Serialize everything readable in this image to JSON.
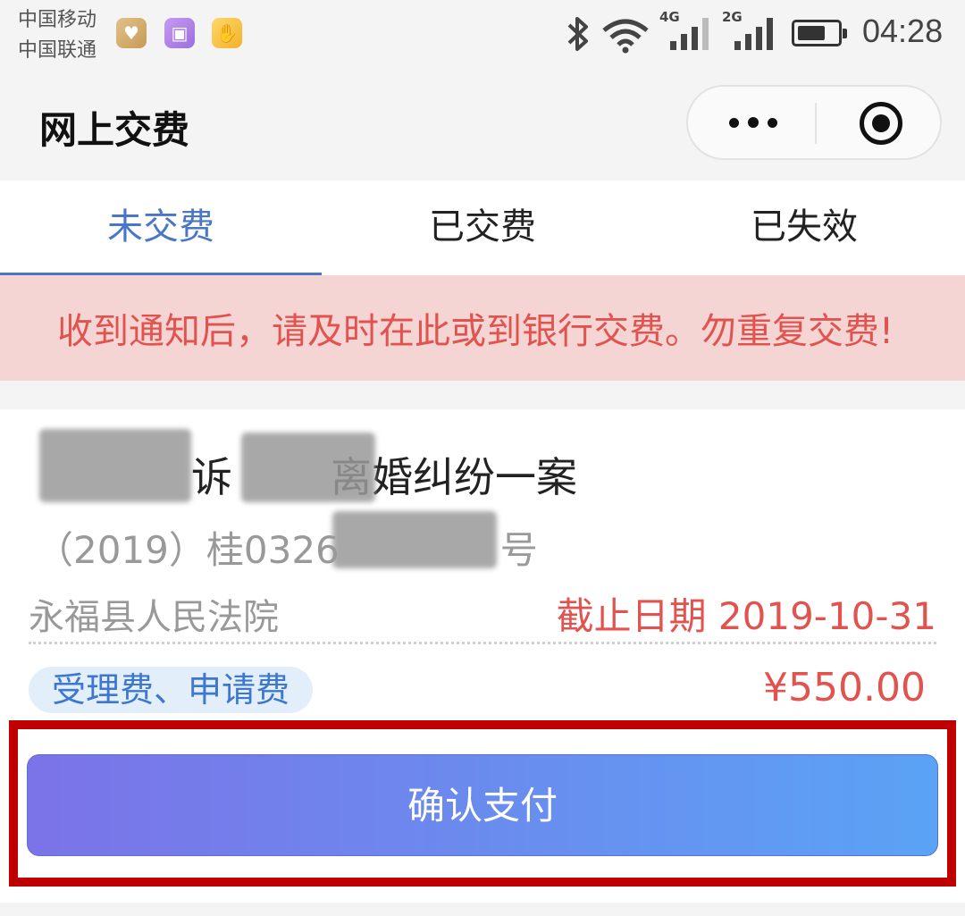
{
  "status_bar": {
    "carrier_1": "中国移动",
    "carrier_2": "中国联通",
    "network_1": "4G",
    "network_2": "2G",
    "time": "04:28",
    "icons": [
      "health-app-icon",
      "gallery-app-icon",
      "hand-app-icon",
      "bluetooth-icon",
      "wifi-icon",
      "signal-icon",
      "battery-icon"
    ]
  },
  "navbar": {
    "title": "网上交费"
  },
  "tabs": [
    {
      "label": "未交费",
      "active": true
    },
    {
      "label": "已交费",
      "active": false
    },
    {
      "label": "已失效",
      "active": false
    }
  ],
  "notice": "收到通知后，请及时在此或到银行交费。勿重复交费!",
  "case": {
    "title_visible_1": "诉",
    "title_visible_2": "离婚纠纷一案",
    "number_prefix": "（2019）桂0326",
    "number_suffix": "号",
    "court": "永福县人民法院",
    "deadline": "截止日期 2019-10-31",
    "fee_type": "受理费、申请费",
    "amount": "¥550.00"
  },
  "actions": {
    "pay_label": "确认支付"
  },
  "colors": {
    "accent": "#4a76c8",
    "alert": "#e0534e",
    "notice_bg": "#f5d4d4",
    "highlight_border": "#c00000"
  }
}
